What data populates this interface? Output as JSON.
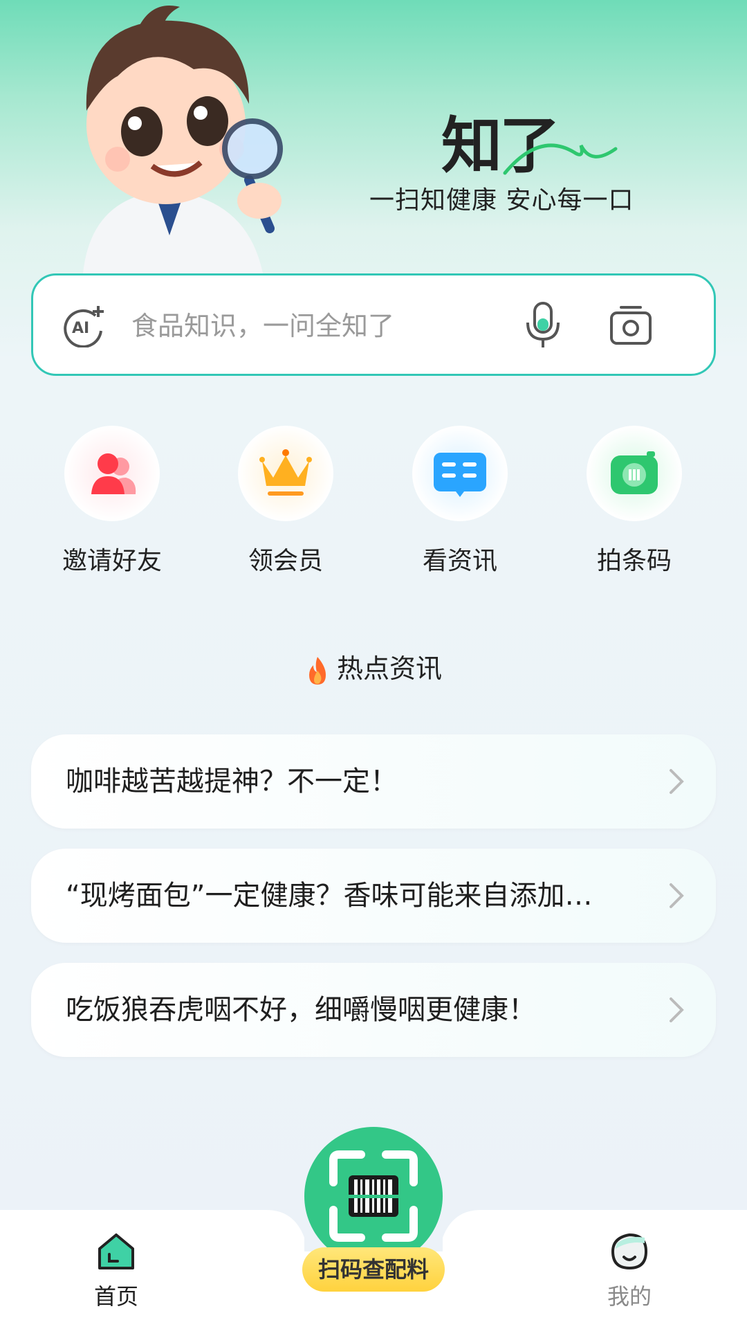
{
  "brand": {
    "logo_text": "知了",
    "slogan": "一扫知健康 安心每一口"
  },
  "search": {
    "placeholder": "食品知识，一问全知了",
    "icons": [
      "ai-plus-icon",
      "microphone-icon",
      "camera-icon"
    ]
  },
  "quick_actions": [
    {
      "label": "邀请好友",
      "icon": "invite-friends-icon",
      "color": "#ff4a55"
    },
    {
      "label": "领会员",
      "icon": "crown-icon",
      "color": "#ffb020"
    },
    {
      "label": "看资讯",
      "icon": "news-icon",
      "color": "#2aa5ff"
    },
    {
      "label": "拍条码",
      "icon": "barcode-camera-icon",
      "color": "#2ec76f"
    }
  ],
  "hot_news": {
    "title": "热点资讯",
    "items": [
      {
        "text": "咖啡越苦越提神？不一定！"
      },
      {
        "text": "“现烤面包”一定健康？香味可能来自添加…"
      },
      {
        "text": "吃饭狼吞虎咽不好，细嚼慢咽更健康！"
      }
    ]
  },
  "tabbar": {
    "home_label": "首页",
    "scan_label": "扫码查配料",
    "me_label": "我的"
  },
  "colors": {
    "accent": "#33c787",
    "search_border": "#32c7b6",
    "scan_label_bg": "#ffd23e"
  }
}
